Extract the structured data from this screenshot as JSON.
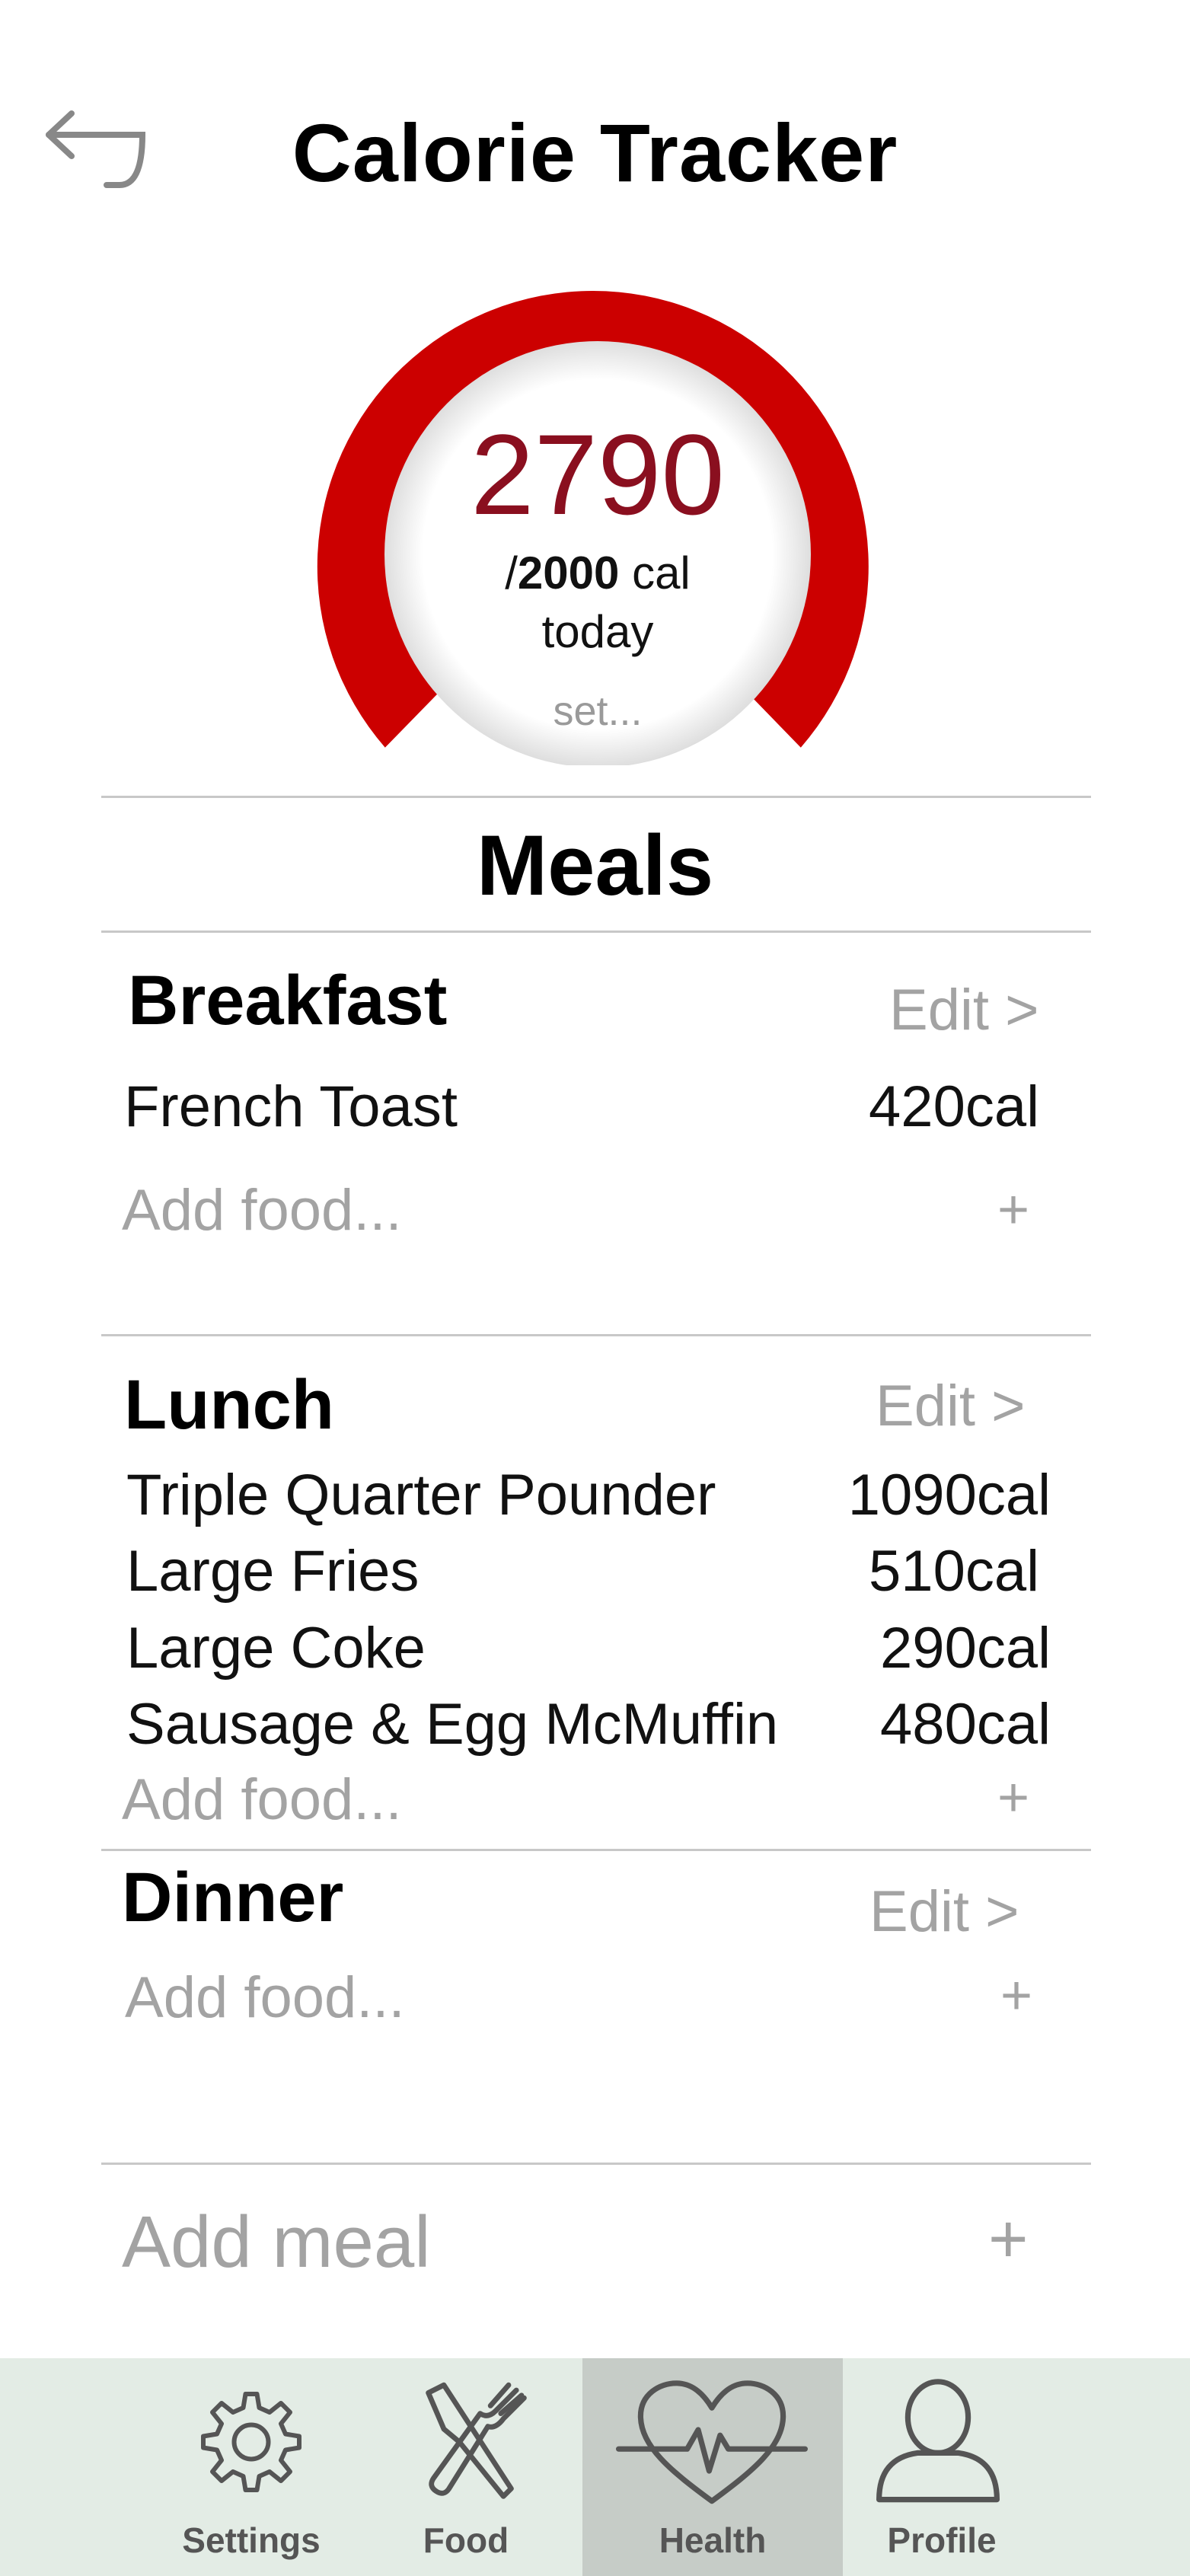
{
  "header": {
    "title": "Calorie Tracker",
    "back_icon": "back-arrow-icon"
  },
  "gauge": {
    "consumed": "2790",
    "goal_prefix": "/",
    "goal": "2000",
    "unit": "cal",
    "period": "today",
    "set_label": "set...",
    "progress_fraction": 1.0,
    "color": "#cc0000"
  },
  "meals_heading": "Meals",
  "meals": [
    {
      "name": "Breakfast",
      "edit_label": "Edit >",
      "items": [
        {
          "name": "French Toast",
          "cal": "420cal"
        }
      ],
      "add_food": "Add food...",
      "add_plus": "+"
    },
    {
      "name": "Lunch",
      "edit_label": "Edit >",
      "items": [
        {
          "name": "Triple Quarter Pounder",
          "cal": "1090cal"
        },
        {
          "name": "Large Fries",
          "cal": "510cal"
        },
        {
          "name": "Large Coke",
          "cal": "290cal"
        },
        {
          "name": "Sausage & Egg McMuffin",
          "cal": "480cal"
        }
      ],
      "add_food": "Add food...",
      "add_plus": "+"
    },
    {
      "name": "Dinner",
      "edit_label": "Edit >",
      "items": [],
      "add_food": "Add food...",
      "add_plus": "+"
    }
  ],
  "add_meal": {
    "label": "Add meal",
    "plus": "+"
  },
  "tabbar": {
    "tabs": [
      {
        "label": "Settings",
        "icon": "gear-icon",
        "active": false
      },
      {
        "label": "Food",
        "icon": "fork-knife-icon",
        "active": false
      },
      {
        "label": "Health",
        "icon": "heart-pulse-icon",
        "active": true
      },
      {
        "label": "Profile",
        "icon": "person-icon",
        "active": false
      }
    ]
  },
  "colors": {
    "accent": "#cc0000",
    "consumed_text": "#8a0f1f",
    "muted": "#a3a3a3",
    "tabbar_bg": "#e3ece5",
    "tab_active_bg": "#c6ccc7"
  }
}
